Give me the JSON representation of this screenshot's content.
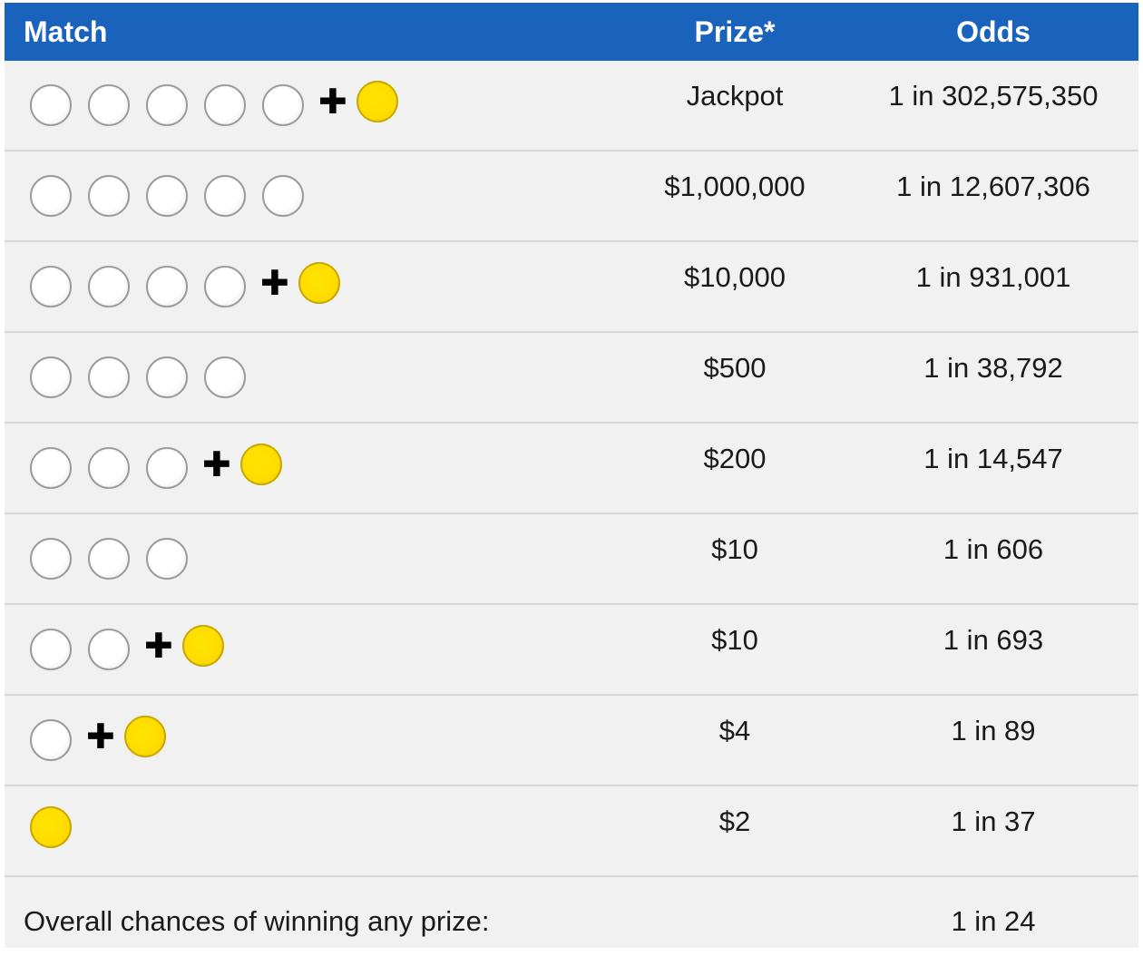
{
  "header": {
    "match": "Match",
    "prize": "Prize*",
    "odds": "Odds"
  },
  "rows": [
    {
      "white_balls": 5,
      "gold_ball": true,
      "prize": "Jackpot",
      "odds": "1 in 302,575,350"
    },
    {
      "white_balls": 5,
      "gold_ball": false,
      "prize": "$1,000,000",
      "odds": "1 in 12,607,306"
    },
    {
      "white_balls": 4,
      "gold_ball": true,
      "prize": "$10,000",
      "odds": "1 in 931,001"
    },
    {
      "white_balls": 4,
      "gold_ball": false,
      "prize": "$500",
      "odds": "1 in 38,792"
    },
    {
      "white_balls": 3,
      "gold_ball": true,
      "prize": "$200",
      "odds": "1 in 14,547"
    },
    {
      "white_balls": 3,
      "gold_ball": false,
      "prize": "$10",
      "odds": "1 in 606"
    },
    {
      "white_balls": 2,
      "gold_ball": true,
      "prize": "$10",
      "odds": "1 in 693"
    },
    {
      "white_balls": 1,
      "gold_ball": true,
      "prize": "$4",
      "odds": "1 in 89"
    },
    {
      "white_balls": 0,
      "gold_ball": true,
      "prize": "$2",
      "odds": "1 in 37"
    }
  ],
  "footer": {
    "label": "Overall chances of winning any prize:",
    "odds": "1 in 24"
  },
  "colors": {
    "header_bg": "#1a63bd",
    "row_bg": "#f1f1f1",
    "gold_ball": "#ffdc00",
    "plus": "#000000"
  }
}
